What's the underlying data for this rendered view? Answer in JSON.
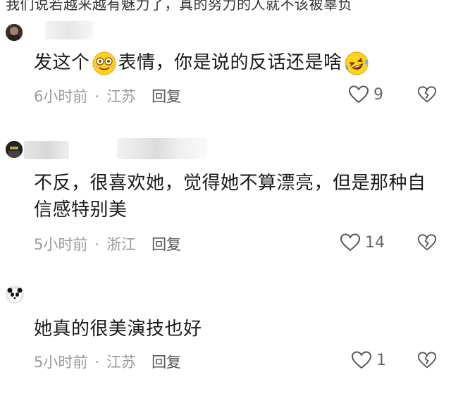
{
  "header": {
    "cut_text": "我们说若越来越有魅力了，真的努力的人就不该被辜负"
  },
  "comments": [
    {
      "text_before": "发这个",
      "text_mid": "表情，你是说的反话还是啥",
      "time": "6小时前",
      "location": "江苏",
      "reply": "回复",
      "likes": "9"
    },
    {
      "text": "不反，很喜欢她，觉得她不算漂亮，但是那种自信感特别美",
      "time": "5小时前",
      "location": "浙江",
      "reply": "回复",
      "likes": "14"
    },
    {
      "text": "她真的很美演技也好",
      "time": "5小时前",
      "location": "江苏",
      "reply": "回复",
      "likes": "1"
    }
  ],
  "meta_separator": "·",
  "colors": {
    "meta": "#9a9a9a",
    "text": "#1a1a1a",
    "background": "#ffffff"
  }
}
